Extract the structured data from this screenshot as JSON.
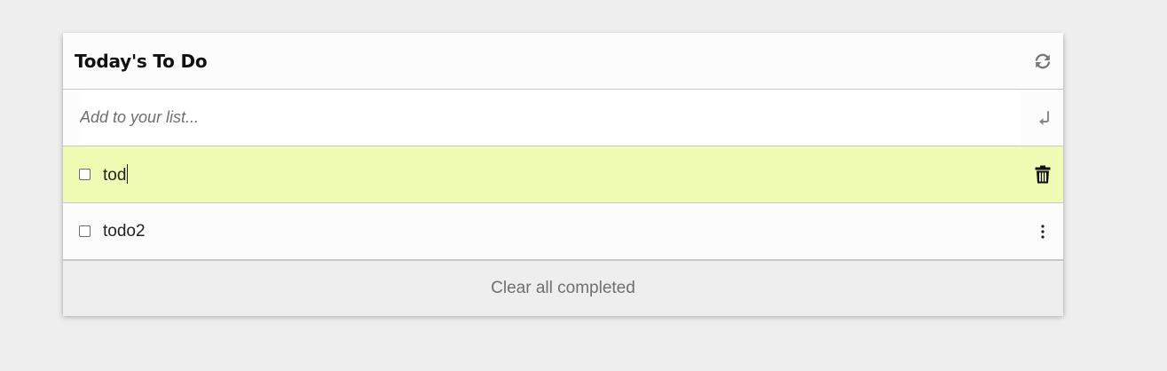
{
  "header": {
    "title": "Today's To Do",
    "refresh_icon": "refresh-icon"
  },
  "add": {
    "placeholder": "Add to your list...",
    "value": "",
    "enter_icon": "enter-icon"
  },
  "items": [
    {
      "label": "tod",
      "checked": false,
      "editing": true,
      "action_icon": "trash-icon"
    },
    {
      "label": "todo2",
      "checked": false,
      "editing": false,
      "action_icon": "more-vertical-icon"
    }
  ],
  "footer": {
    "clear_label": "Clear all completed"
  },
  "colors": {
    "highlight": "#f0fbb4",
    "background": "#eeeeee",
    "card": "#fcfcfc"
  }
}
